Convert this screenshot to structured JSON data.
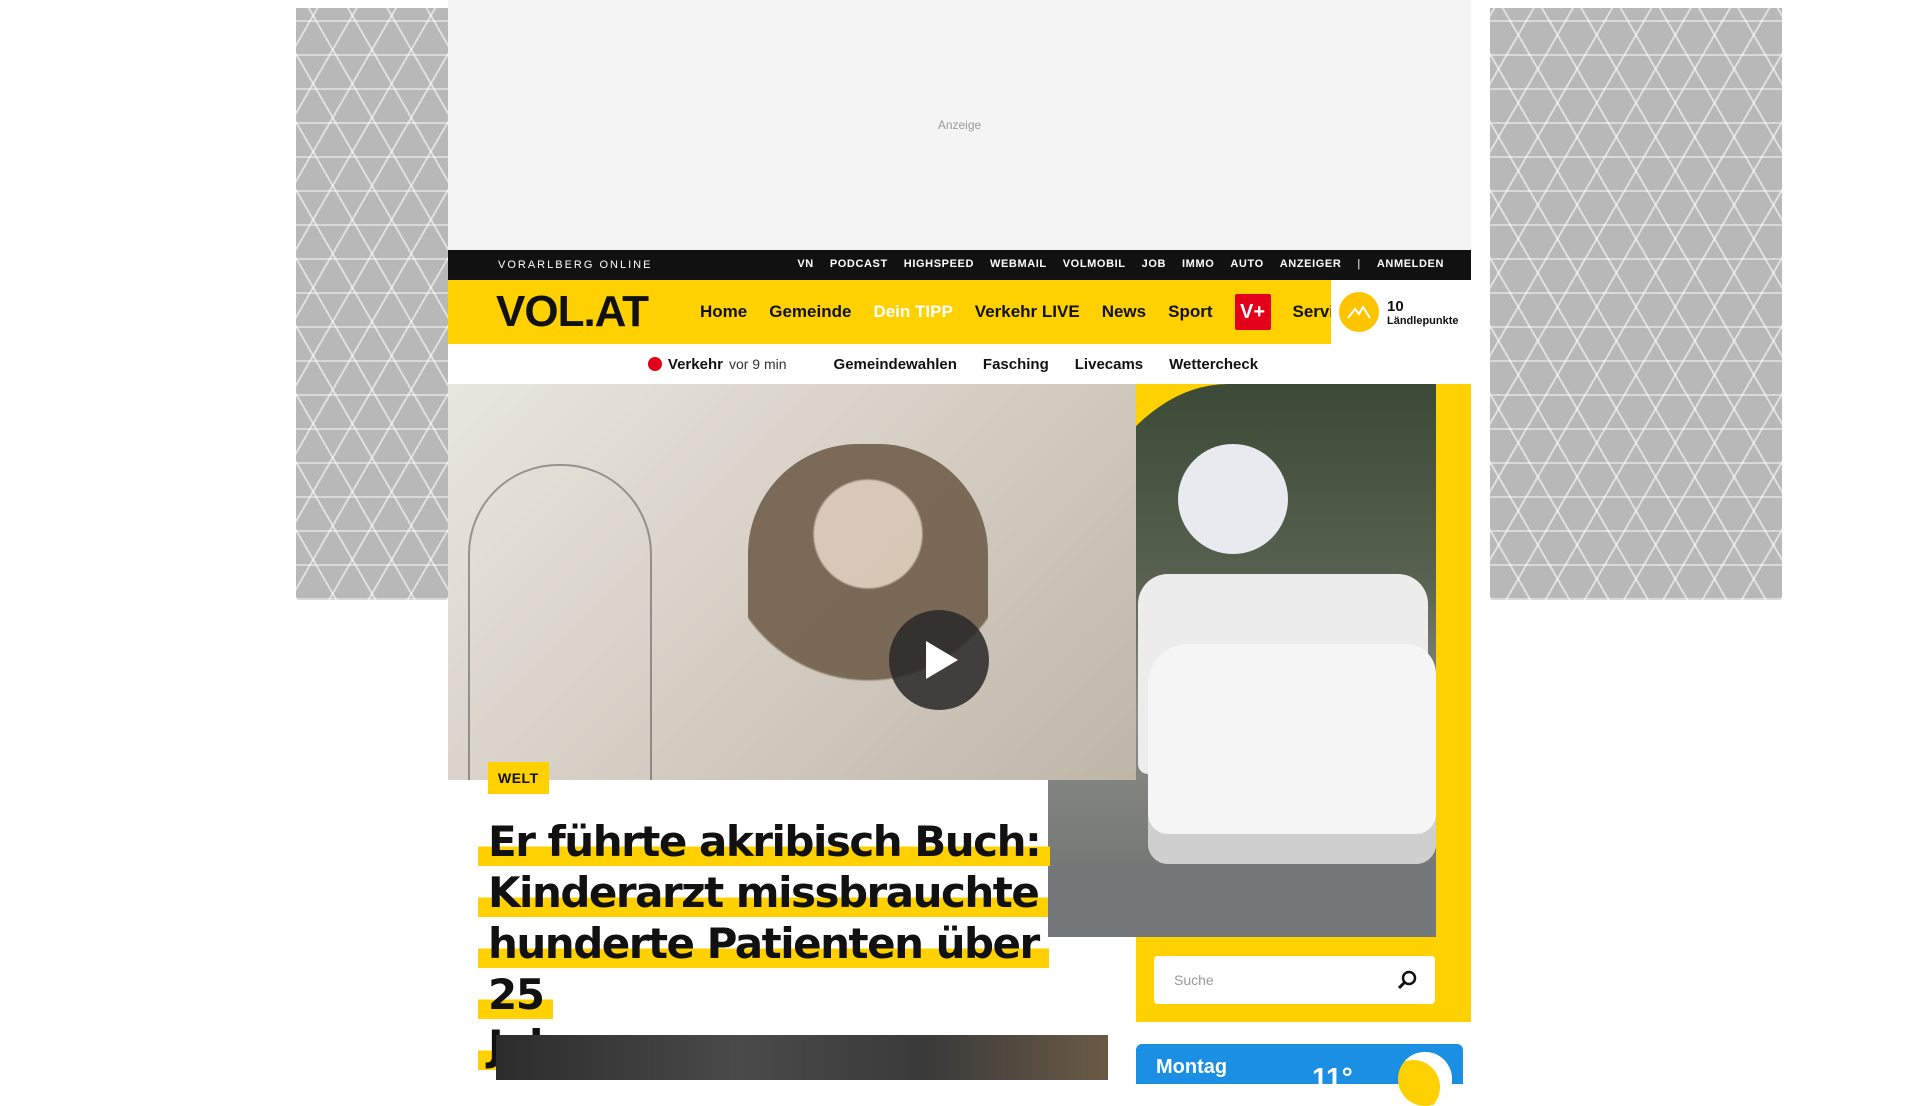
{
  "ad": {
    "label": "Anzeige"
  },
  "topbar": {
    "brand": "VORARLBERG ONLINE",
    "links": [
      "VN",
      "PODCAST",
      "HIGHSPEED",
      "WEBMAIL",
      "VOLMOBIL",
      "JOB",
      "IMMO",
      "AUTO",
      "ANZEIGER"
    ],
    "separator": "|",
    "login": "ANMELDEN"
  },
  "header": {
    "logo": "VOL.AT",
    "nav": [
      "Home",
      "Gemeinde",
      "Dein TIPP",
      "Verkehr LIVE",
      "News",
      "Sport"
    ],
    "vplus": "V+",
    "service": "Service",
    "points": {
      "value": "10",
      "label": "Ländlepunkte",
      "icon": "mountain-icon"
    }
  },
  "subnav": {
    "traffic": {
      "label": "Verkehr",
      "time": "vor 9 min",
      "status_color": "#e2001a"
    },
    "items": [
      "Gemeindewahlen",
      "Fasching",
      "Livecams",
      "Wettercheck"
    ]
  },
  "article": {
    "category": "WELT",
    "headline_lines": [
      "Er führte akribisch Buch:",
      "Kinderarzt missbrauchte",
      "hunderte Patienten über 25",
      "Jahre"
    ],
    "has_video": true
  },
  "search": {
    "placeholder": "Suche",
    "icon": "search-icon"
  },
  "weather": {
    "day": "Montag",
    "temp": "11°"
  },
  "colors": {
    "brand_yellow": "#ffd100",
    "brand_black": "#111111",
    "accent_red": "#e2001a",
    "weather_blue": "#1a8fe3"
  }
}
